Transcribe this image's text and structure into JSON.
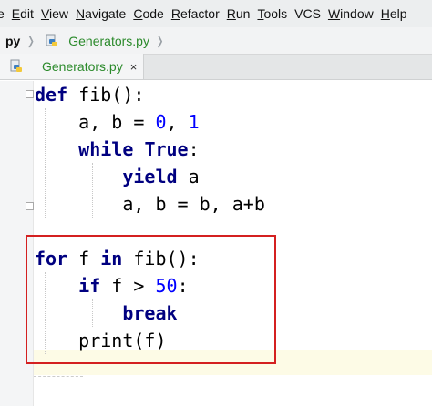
{
  "menu": {
    "items": [
      {
        "mnemonic": "",
        "rest": "e"
      },
      {
        "mnemonic": "E",
        "rest": "dit"
      },
      {
        "mnemonic": "V",
        "rest": "iew"
      },
      {
        "mnemonic": "N",
        "rest": "avigate"
      },
      {
        "mnemonic": "C",
        "rest": "ode"
      },
      {
        "mnemonic": "R",
        "rest": "efactor"
      },
      {
        "mnemonic": "R",
        "rest": "un"
      },
      {
        "mnemonic": "T",
        "rest": "ools"
      },
      {
        "mnemonic": "",
        "rest": "VCS"
      },
      {
        "mnemonic": "W",
        "rest": "indow"
      },
      {
        "mnemonic": "H",
        "rest": "elp"
      }
    ]
  },
  "navbar": {
    "project": "py",
    "file": "Generators.py",
    "separator": "❭"
  },
  "tabs": [
    {
      "label": "Generators.py",
      "close": "×"
    }
  ],
  "editor": {
    "lines": [
      [
        {
          "t": "kw",
          "s": "def"
        },
        {
          "t": "pl",
          "s": " fib():"
        }
      ],
      [
        {
          "t": "pl",
          "s": "    a, b = "
        },
        {
          "t": "num",
          "s": "0"
        },
        {
          "t": "pl",
          "s": ", "
        },
        {
          "t": "num",
          "s": "1"
        }
      ],
      [
        {
          "t": "pl",
          "s": "    "
        },
        {
          "t": "kw",
          "s": "while"
        },
        {
          "t": "pl",
          "s": " "
        },
        {
          "t": "kw",
          "s": "True"
        },
        {
          "t": "pl",
          "s": ":"
        }
      ],
      [
        {
          "t": "pl",
          "s": "        "
        },
        {
          "t": "kw",
          "s": "yield"
        },
        {
          "t": "pl",
          "s": " a"
        }
      ],
      [
        {
          "t": "pl",
          "s": "        a, b = b, a+b"
        }
      ],
      [
        {
          "t": "pl",
          "s": ""
        }
      ],
      [
        {
          "t": "kw",
          "s": "for"
        },
        {
          "t": "pl",
          "s": " f "
        },
        {
          "t": "kw",
          "s": "in"
        },
        {
          "t": "pl",
          "s": " fib():"
        }
      ],
      [
        {
          "t": "pl",
          "s": "    "
        },
        {
          "t": "kw",
          "s": "if"
        },
        {
          "t": "pl",
          "s": " f > "
        },
        {
          "t": "num",
          "s": "50"
        },
        {
          "t": "pl",
          "s": ":"
        }
      ],
      [
        {
          "t": "pl",
          "s": "        "
        },
        {
          "t": "kw",
          "s": "break"
        }
      ],
      [
        {
          "t": "pl",
          "s": "    print(f)"
        }
      ]
    ]
  },
  "colors": {
    "keyword": "#000080",
    "number": "#0000ff",
    "filename_green": "#2b8a2b",
    "highlight_box": "#d42020",
    "caret_line": "#fdfbe6"
  },
  "icons": {
    "file": "python-file-icon",
    "separator": "chevron-right-icon",
    "fold": "fold-marker-icon"
  }
}
